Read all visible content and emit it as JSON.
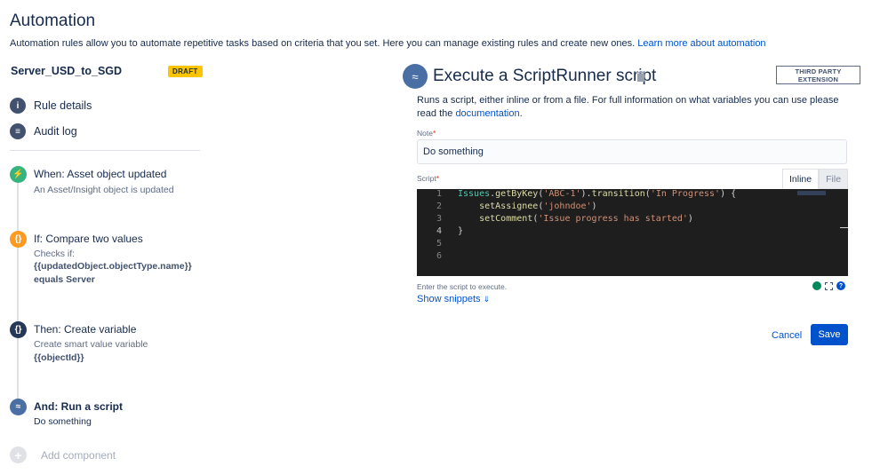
{
  "header": {
    "title": "Automation",
    "description": "Automation rules allow you to automate repetitive tasks based on criteria that you set. Here you can manage existing rules and create new ones.",
    "learn_more": "Learn more about automation"
  },
  "rule": {
    "name": "Server_USD_to_SGD",
    "status": "DRAFT"
  },
  "nav": {
    "rule_details": "Rule details",
    "audit_log": "Audit log"
  },
  "components": {
    "trigger": {
      "title": "When: Asset object updated",
      "subtitle": "An Asset/Insight object is updated"
    },
    "condition": {
      "title": "If: Compare two values",
      "subtitle": "Checks if:",
      "value": "{{updatedObject.objectType.name}}",
      "operator": "equals Server"
    },
    "action_var": {
      "title": "Then: Create variable",
      "subtitle": "Create smart value variable",
      "value": "{{objectId}}"
    },
    "action_script": {
      "title": "And: Run a script",
      "subtitle": "Do something"
    },
    "add_label": "Add component"
  },
  "detail": {
    "title": "Execute a ScriptRunner script",
    "badge_line1": "THIRD PARTY",
    "badge_line2": "EXTENSION",
    "description": "Runs a script, either inline or from a file. For full information on what variables you can use please read the",
    "doc_link": "documentation",
    "note_label": "Note",
    "note_value": "Do something",
    "script_label": "Script",
    "tabs": {
      "inline": "Inline",
      "file": "File"
    },
    "editor_hint": "Enter the script to execute.",
    "show_snippets": "Show snippets",
    "cancel": "Cancel",
    "save": "Save"
  },
  "code": {
    "line_numbers": [
      "1",
      "2",
      "3",
      "4",
      "5",
      "6"
    ],
    "l1": {
      "cls": "Issues",
      "dot": ".",
      "fn1": "getByKey",
      "p1": "(",
      "s1": "'ABC-1'",
      "p2": ").",
      "fn2": "transition",
      "p3": "(",
      "s2": "'In Progress'",
      "p4": ") {"
    },
    "l2": {
      "fn": "setAssignee",
      "p1": "(",
      "s": "'johndoe'",
      "p2": ")"
    },
    "l3": {
      "fn": "setComment",
      "p1": "(",
      "s": "'Issue progress has started'",
      "p2": ")"
    },
    "l4": "}"
  },
  "colors": {
    "primary": "#0052cc",
    "draft": "#ffc400",
    "trigger": "#36b37e",
    "condition": "#ff991f",
    "action": "#253858",
    "script_action": "#4a6fa5"
  },
  "icons": {
    "rule_details": "info-icon",
    "audit_log": "list-icon",
    "trigger": "lightning-icon",
    "condition": "braces-icon",
    "action_var": "braces-icon",
    "action_script": "script-icon",
    "add": "plus-icon",
    "trash": "trash-icon"
  }
}
